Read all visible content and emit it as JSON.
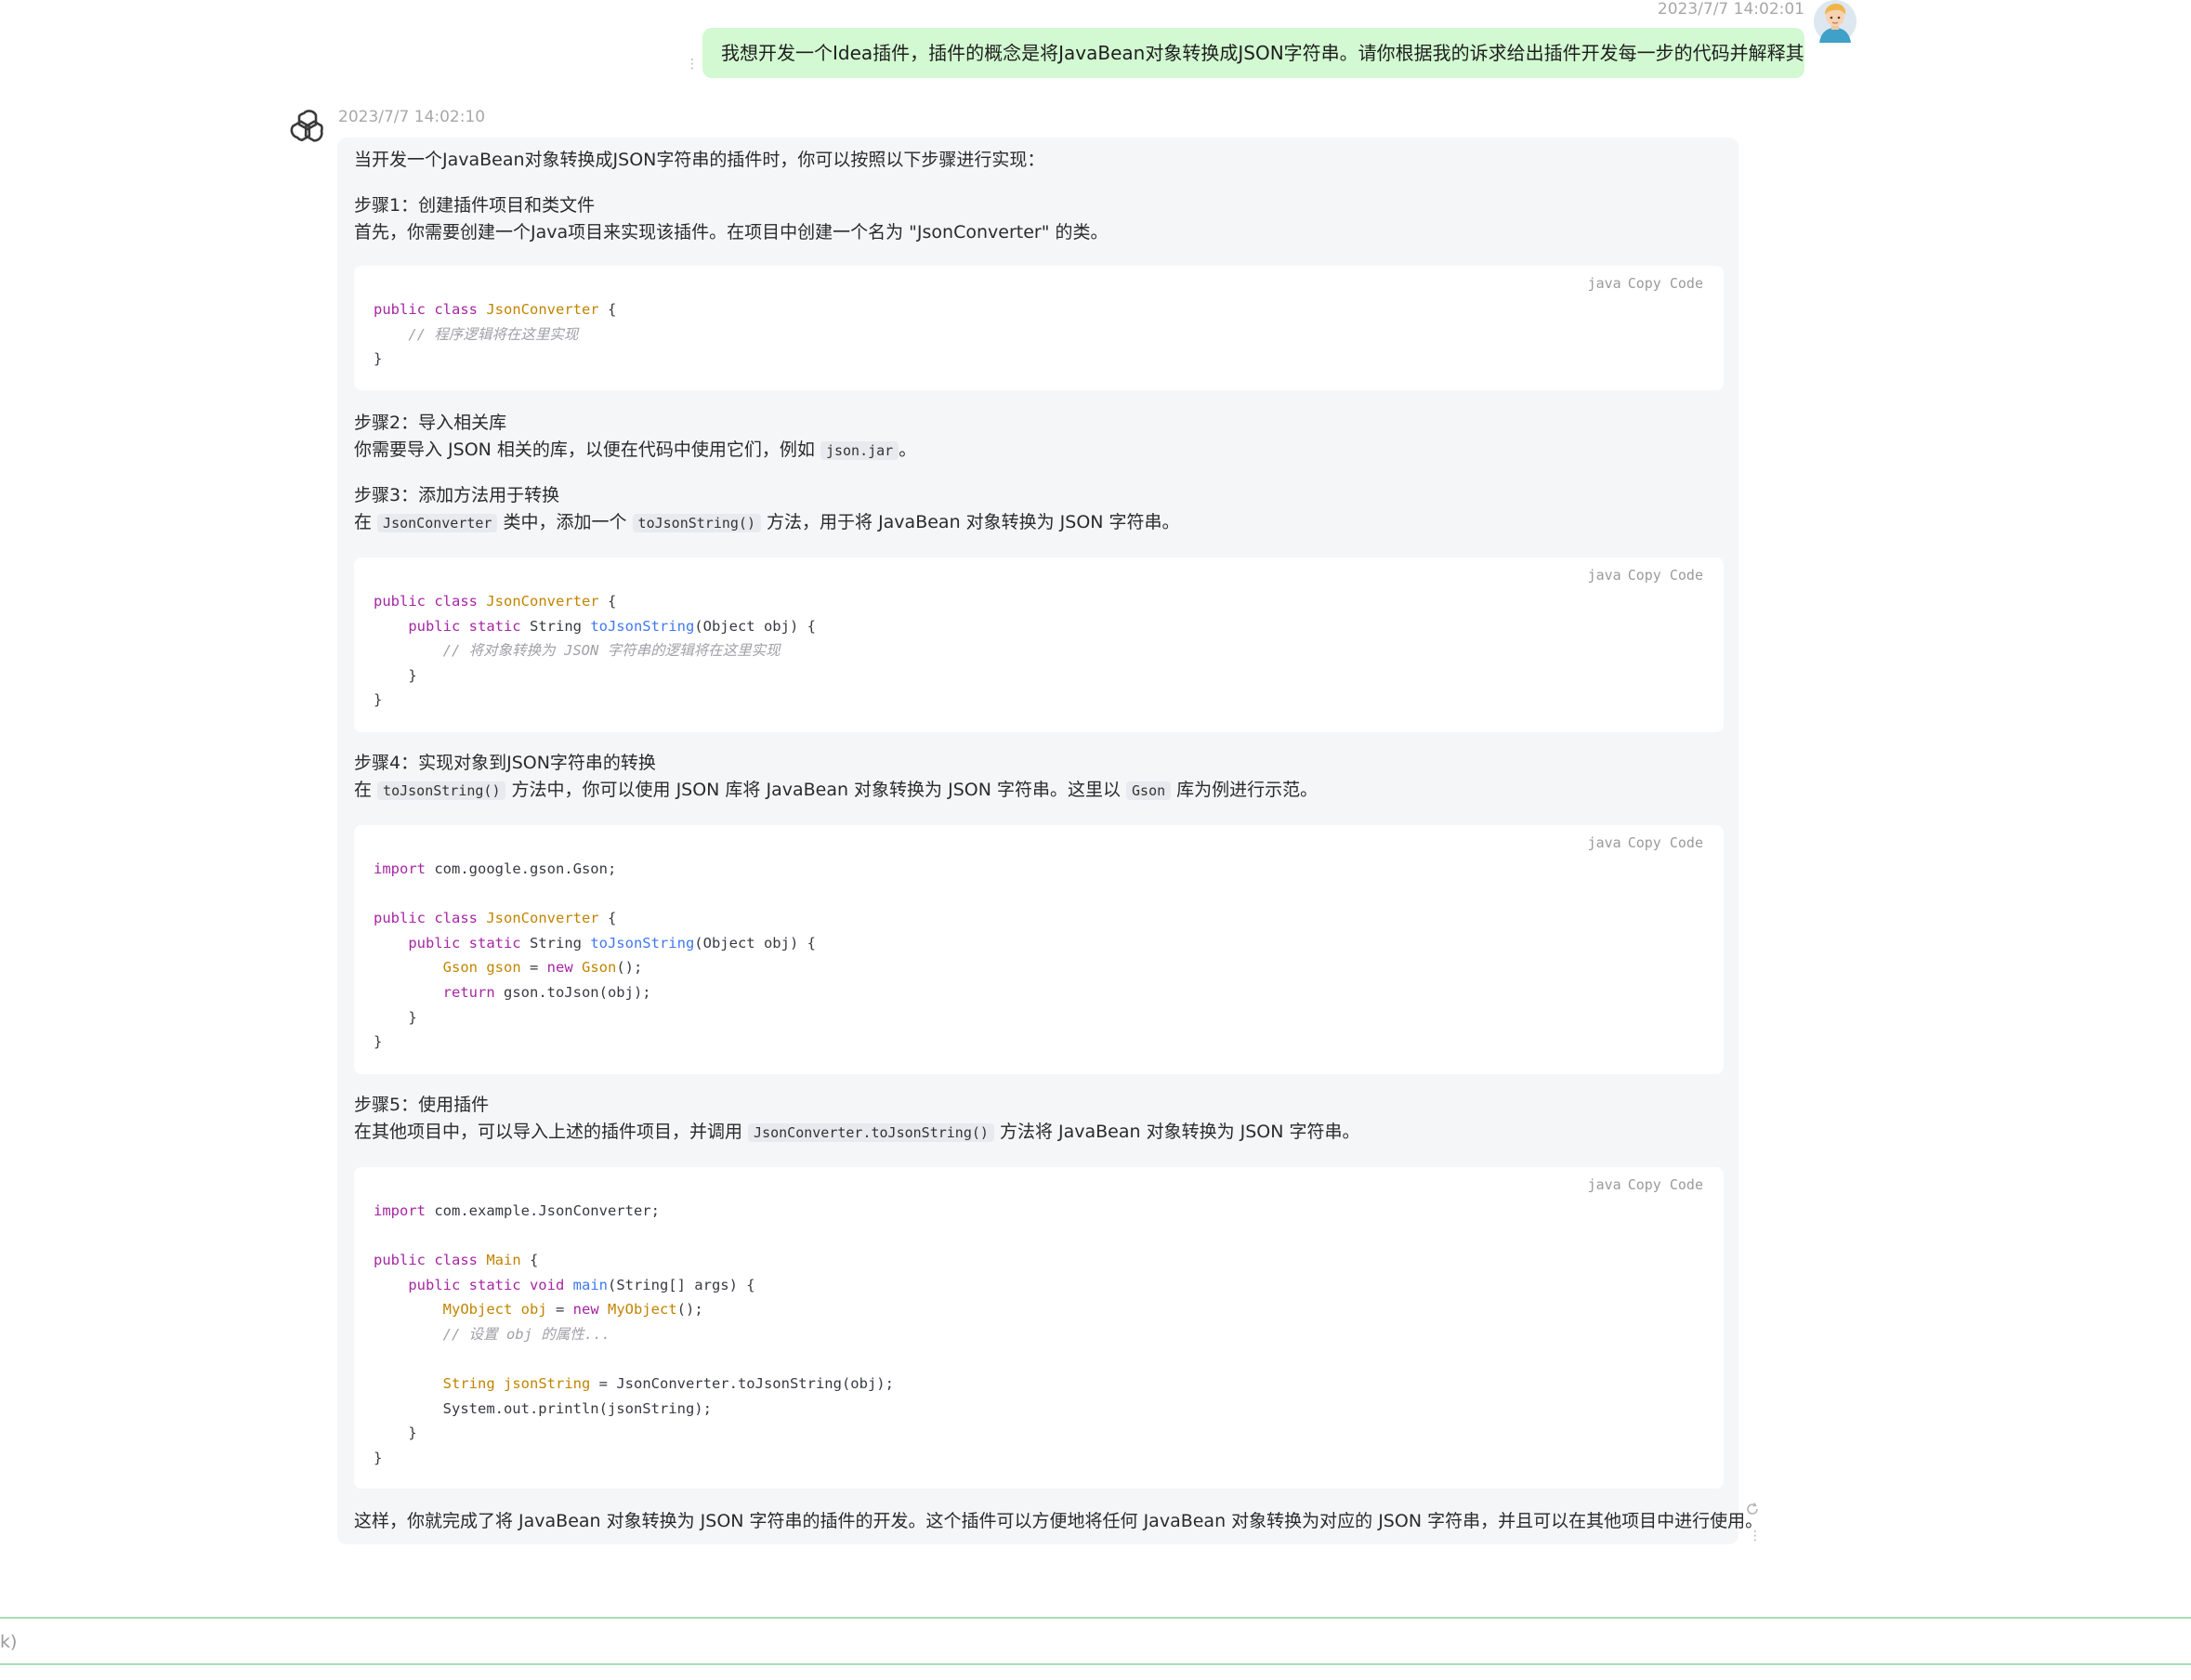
{
  "user_message": {
    "timestamp": "2023/7/7 14:02:01",
    "text": "我想开发一个Idea插件，插件的概念是将JavaBean对象转换成JSON字符串。请你根据我的诉求给出插件开发每一步的代码并解释其含义。",
    "avatar_icon": "user-avatar-icon",
    "bubble_color": "#d2f9d1"
  },
  "assistant_message": {
    "timestamp": "2023/7/7 14:02:10",
    "avatar_icon": "openai-logo-icon",
    "intro": "当开发一个JavaBean对象转换成JSON字符串的插件时，你可以按照以下步骤进行实现：",
    "code_bar": {
      "lang": "java",
      "copy": "Copy",
      "code": "Code"
    },
    "step1": {
      "title": "步骤1：创建插件项目和类文件",
      "desc": "首先，你需要创建一个Java项目来实现该插件。在项目中创建一个名为 \"JsonConverter\" 的类。"
    },
    "code1": {
      "lines": [
        "public class JsonConverter {",
        "    // 程序逻辑将在这里实现",
        "}"
      ]
    },
    "step2": {
      "title": "步骤2：导入相关库",
      "desc_before": "你需要导入 JSON 相关的库，以便在代码中使用它们，例如 ",
      "inline": "json.jar",
      "desc_after": "。"
    },
    "step3": {
      "title": "步骤3：添加方法用于转换",
      "p1": "在 ",
      "c1": "JsonConverter",
      "p2": " 类中，添加一个 ",
      "c2": "toJsonString()",
      "p3": " 方法，用于将 JavaBean 对象转换为 JSON 字符串。"
    },
    "code2": {
      "lines": [
        "public class JsonConverter {",
        "    public static String toJsonString(Object obj) {",
        "        // 将对象转换为 JSON 字符串的逻辑将在这里实现",
        "    }",
        "}"
      ]
    },
    "step4": {
      "title": "步骤4：实现对象到JSON字符串的转换",
      "p1": "在 ",
      "c1": "toJsonString()",
      "p2": " 方法中，你可以使用 JSON 库将 JavaBean 对象转换为 JSON 字符串。这里以 ",
      "c2": "Gson",
      "p3": " 库为例进行示范。"
    },
    "code3": {
      "lines": [
        "import com.google.gson.Gson;",
        "",
        "public class JsonConverter {",
        "    public static String toJsonString(Object obj) {",
        "        Gson gson = new Gson();",
        "        return gson.toJson(obj);",
        "    }",
        "}"
      ]
    },
    "step5": {
      "title": "步骤5：使用插件",
      "p1": "在其他项目中，可以导入上述的插件项目，并调用 ",
      "c1": "JsonConverter.toJsonString()",
      "p2": " 方法将 JavaBean 对象转换为 JSON 字符串。"
    },
    "code4": {
      "lines": [
        "import com.example.JsonConverter;",
        "",
        "public class Main {",
        "    public static void main(String[] args) {",
        "        MyObject obj = new MyObject();",
        "        // 设置 obj 的属性...",
        "",
        "        String jsonString = JsonConverter.toJsonString(obj);",
        "        System.out.println(jsonString);",
        "    }",
        "}"
      ]
    },
    "conclusion": "这样，你就完成了将 JavaBean 对象转换为 JSON 字符串的插件的开发。这个插件可以方便地将任何 JavaBean 对象转换为对应的 JSON 字符串，并且可以在其他项目中进行使用。",
    "bubble_color": "#f4f6f8"
  },
  "input": {
    "visible_text": "k)",
    "border_color": "#a6dfb4"
  }
}
